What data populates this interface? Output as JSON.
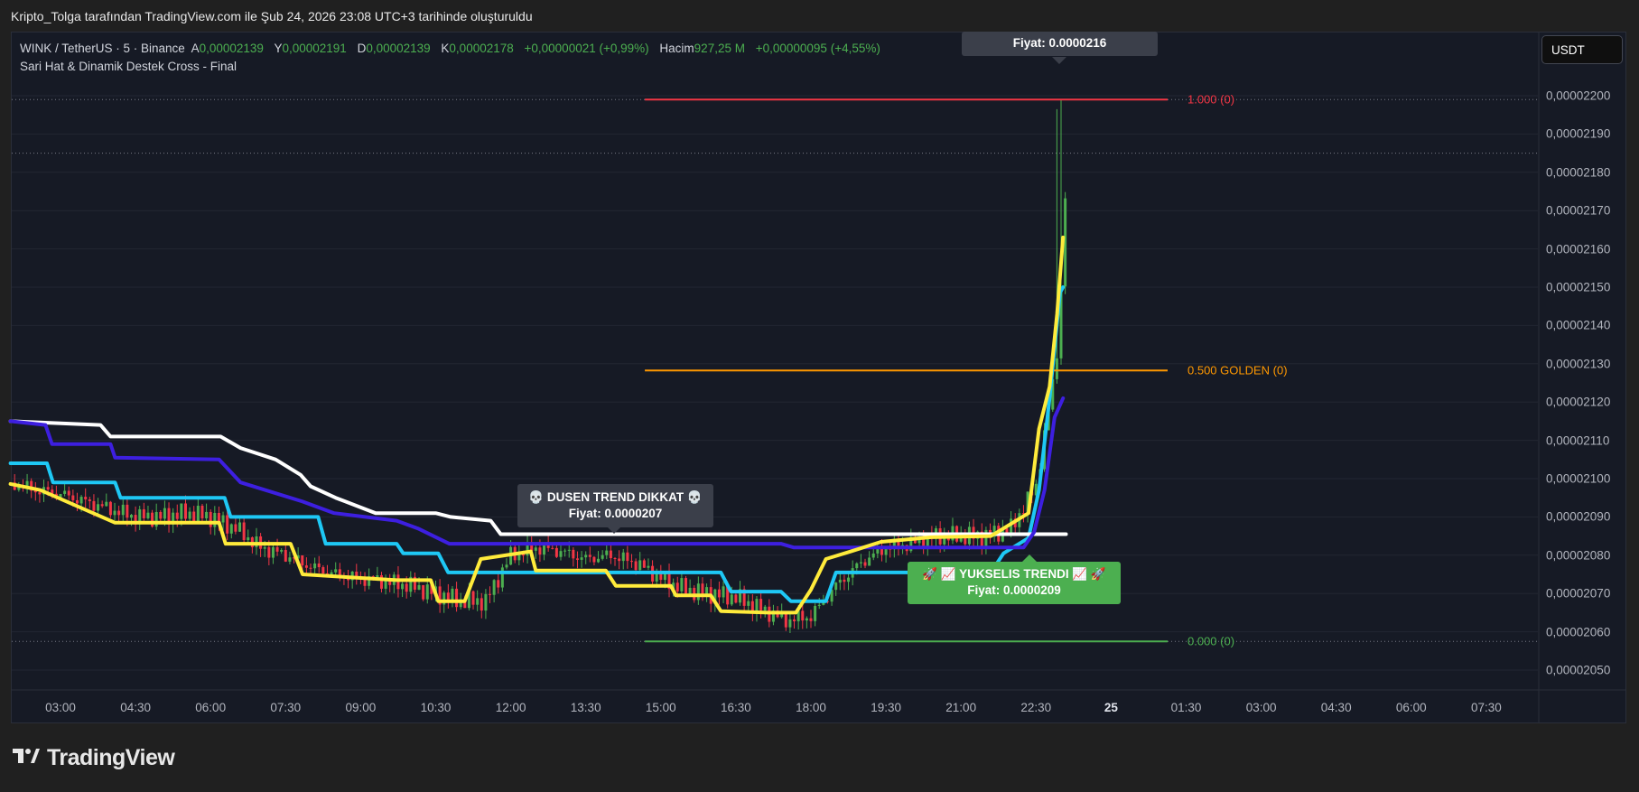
{
  "title": "Kripto_Tolga tarafından TradingView.com ile Şub 24, 2026 23:08 UTC+3 tarihinde oluşturuldu",
  "legend": {
    "symbol": "WINK / TetherUS · 5 · Binance",
    "open_label": "A",
    "open": "0,00002139",
    "high_label": "Y",
    "high": "0,00002191",
    "low_label": "D",
    "low": "0,00002139",
    "close_label": "K",
    "close": "0,00002178",
    "change": "+0,00000021 (+0,99%)",
    "volume_label": "Hacim",
    "volume": "927,25 M",
    "volume_change": "+0,00000095 (+4,55%)",
    "indicator": "Sari Hat & Dinamik Destek Cross - Final"
  },
  "currency_button": "USDT",
  "labels": {
    "top_price": "Fiyat: 0.0000216",
    "dusen_title": "💀 DUSEN TREND DIKKAT 💀",
    "dusen_price": "Fiyat: 0.0000207",
    "yukselis_title": "🚀 📈 YUKSELIS TRENDI 📈 🚀",
    "yukselis_price": "Fiyat: 0.0000209"
  },
  "logo": "TradingView",
  "colors": {
    "up": "#4caf50",
    "down": "#f23645",
    "white_line": "#ffffff",
    "purple_line": "#3d1fe0",
    "cyan_line": "#1ec8f5",
    "yellow_line": "#ffeb3b",
    "fib_1": "#f23645",
    "fib_05": "#ff9800",
    "fib_0": "#4caf50"
  },
  "chart_data": {
    "type": "candlestick",
    "y_unit": "1e-8 USDT",
    "x_unit": "hours since 03:00 (Feb 24)",
    "ylim": [
      2040,
      2210
    ],
    "y_ticks": [
      "0,00002200",
      "0,00002190",
      "0,00002180",
      "0,00002170",
      "0,00002160",
      "0,00002150",
      "0,00002140",
      "0,00002130",
      "0,00002120",
      "0,00002110",
      "0,00002100",
      "0,00002090",
      "0,00002080",
      "0,00002070",
      "0,00002060",
      "0,00002050"
    ],
    "y_tick_values": [
      2200,
      2190,
      2180,
      2170,
      2160,
      2150,
      2140,
      2130,
      2120,
      2110,
      2100,
      2090,
      2080,
      2070,
      2060,
      2050
    ],
    "x_ticks": [
      "03:00",
      "04:30",
      "06:00",
      "07:30",
      "09:00",
      "10:30",
      "12:00",
      "13:30",
      "15:00",
      "16:30",
      "18:00",
      "19:30",
      "21:00",
      "22:30",
      "25",
      "01:30",
      "03:00",
      "04:30",
      "06:00",
      "07:30"
    ],
    "x_ticks_bold": [
      "25"
    ],
    "close_series": [
      [
        -1,
        2099
      ],
      [
        -0.5,
        2097
      ],
      [
        0,
        2096
      ],
      [
        0.5,
        2094
      ],
      [
        1,
        2092
      ],
      [
        1.5,
        2090
      ],
      [
        2,
        2090
      ],
      [
        2.5,
        2091
      ],
      [
        3,
        2090
      ],
      [
        3.5,
        2087
      ],
      [
        4,
        2082
      ],
      [
        4.5,
        2080
      ],
      [
        5,
        2077
      ],
      [
        5.5,
        2075
      ],
      [
        6,
        2074
      ],
      [
        6.5,
        2073
      ],
      [
        7,
        2072
      ],
      [
        7.5,
        2070
      ],
      [
        8,
        2068
      ],
      [
        8.5,
        2068
      ],
      [
        9,
        2080
      ],
      [
        9.5,
        2082
      ],
      [
        10,
        2081
      ],
      [
        10.5,
        2079
      ],
      [
        11,
        2080
      ],
      [
        11.5,
        2078
      ],
      [
        12,
        2074
      ],
      [
        12.5,
        2071
      ],
      [
        13,
        2070
      ],
      [
        13.5,
        2069
      ],
      [
        14,
        2066
      ],
      [
        14.5,
        2063
      ],
      [
        15,
        2064
      ],
      [
        15.5,
        2072
      ],
      [
        16,
        2078
      ],
      [
        16.5,
        2082
      ],
      [
        17,
        2083
      ],
      [
        17.5,
        2085
      ],
      [
        18,
        2085
      ],
      [
        18.5,
        2085
      ],
      [
        19,
        2087
      ],
      [
        19.5,
        2098
      ],
      [
        19.9,
        2130
      ],
      [
        20.0,
        2150
      ],
      [
        20.1,
        2178
      ]
    ],
    "spike_high": 2199,
    "series": [
      {
        "name": "white",
        "points": [
          [
            -1,
            2115
          ],
          [
            0.8,
            2114
          ],
          [
            1,
            2111
          ],
          [
            3.2,
            2111
          ],
          [
            3.6,
            2108
          ],
          [
            4.3,
            2105
          ],
          [
            4.8,
            2101
          ],
          [
            5.0,
            2098
          ],
          [
            5.5,
            2095
          ],
          [
            6.3,
            2091
          ],
          [
            7.5,
            2091
          ],
          [
            7.8,
            2090
          ],
          [
            8.6,
            2089
          ],
          [
            8.8,
            2085.5
          ],
          [
            20.1,
            2085.5
          ]
        ]
      },
      {
        "name": "purple",
        "points": [
          [
            -1,
            2115
          ],
          [
            -0.3,
            2114
          ],
          [
            -0.17,
            2109
          ],
          [
            1.0,
            2109
          ],
          [
            1.09,
            2105.5
          ],
          [
            3.17,
            2105
          ],
          [
            3.6,
            2099
          ],
          [
            4.84,
            2094
          ],
          [
            5.47,
            2091
          ],
          [
            6.72,
            2089
          ],
          [
            7.14,
            2087
          ],
          [
            7.77,
            2083
          ],
          [
            14.4,
            2083
          ],
          [
            14.66,
            2082
          ],
          [
            19.25,
            2082
          ],
          [
            19.46,
            2086
          ],
          [
            19.67,
            2097
          ],
          [
            19.87,
            2116
          ],
          [
            20.04,
            2121
          ]
        ]
      },
      {
        "name": "cyan",
        "points": [
          [
            -1,
            2104
          ],
          [
            -0.27,
            2104
          ],
          [
            -0.15,
            2099
          ],
          [
            1.09,
            2099
          ],
          [
            1.2,
            2095
          ],
          [
            3.28,
            2095
          ],
          [
            3.4,
            2090
          ],
          [
            5.15,
            2090
          ],
          [
            5.3,
            2083
          ],
          [
            6.72,
            2083
          ],
          [
            6.85,
            2080.5
          ],
          [
            7.55,
            2080.5
          ],
          [
            7.75,
            2075.5
          ],
          [
            13.2,
            2075.5
          ],
          [
            13.4,
            2070.5
          ],
          [
            14.4,
            2070.5
          ],
          [
            14.6,
            2068
          ],
          [
            15.3,
            2068
          ],
          [
            15.5,
            2075.5
          ],
          [
            18.6,
            2075.5
          ],
          [
            18.85,
            2080.5
          ],
          [
            19.35,
            2084.5
          ],
          [
            19.56,
            2097
          ],
          [
            19.77,
            2121
          ],
          [
            19.98,
            2148.6
          ],
          [
            20.04,
            2150
          ]
        ]
      },
      {
        "name": "yellow",
        "points": [
          [
            -1,
            2098.6
          ],
          [
            -0.4,
            2097
          ],
          [
            0.3,
            2093
          ],
          [
            1.09,
            2088.5
          ],
          [
            3.17,
            2088.5
          ],
          [
            3.3,
            2083
          ],
          [
            4.6,
            2083
          ],
          [
            4.84,
            2075
          ],
          [
            6.72,
            2073.5
          ],
          [
            7.4,
            2073.5
          ],
          [
            7.55,
            2068
          ],
          [
            8.08,
            2068
          ],
          [
            8.4,
            2079
          ],
          [
            9.4,
            2081
          ],
          [
            9.5,
            2076
          ],
          [
            10.9,
            2076
          ],
          [
            11.1,
            2072
          ],
          [
            12.2,
            2072
          ],
          [
            12.3,
            2069.5
          ],
          [
            13.0,
            2069.5
          ],
          [
            13.2,
            2065.4
          ],
          [
            14.15,
            2065
          ],
          [
            14.7,
            2065
          ],
          [
            15.0,
            2071
          ],
          [
            15.3,
            2079
          ],
          [
            15.8,
            2081
          ],
          [
            16.4,
            2083.5
          ],
          [
            17.4,
            2084.7
          ],
          [
            18.6,
            2085
          ],
          [
            19.35,
            2091
          ],
          [
            19.56,
            2113
          ],
          [
            19.77,
            2124
          ],
          [
            19.92,
            2143
          ],
          [
            20.04,
            2163
          ]
        ]
      }
    ],
    "fibonacci": [
      {
        "label": "1.000 (0)",
        "value": 2199,
        "from": 11.68,
        "to": 22.13
      },
      {
        "label": "0.500 GOLDEN (0)",
        "value": 2128.25,
        "from": 11.68,
        "to": 22.13
      },
      {
        "label": "0.000 (0)",
        "value": 2057.5,
        "from": 11.68,
        "to": 22.13
      }
    ],
    "dotted_levels": [
      2199,
      2185,
      2057.5
    ]
  }
}
